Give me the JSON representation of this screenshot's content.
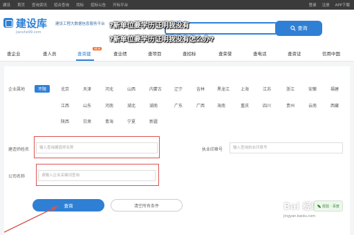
{
  "topbar": {
    "nav": [
      "建设",
      "首页",
      "查询资讯",
      "招合查询",
      "找标",
      "招标公告",
      "开标平台"
    ],
    "right": [
      "登录",
      "注册",
      "APP下载"
    ]
  },
  "header": {
    "logo_text": "建设库",
    "logo_sub": "jianshe99.com",
    "slogan": "建设工程大数据信息服务平台",
    "search_button": "查询"
  },
  "overlay": {
    "line1": "?新单位要学历证明我没有",
    "line2": "?新单位要学历证明我没有怎么办?"
  },
  "subnav": {
    "items": [
      "查企业",
      "查人员",
      "查资建",
      "查业绩",
      "查项目",
      "查招标",
      "查荣誉",
      "查电话",
      "查资证",
      "信用中国"
    ],
    "new_tag": "NEW"
  },
  "filters": {
    "region_label": "企业属地",
    "regions": [
      [
        "不限",
        "北京",
        "天津",
        "河北",
        "山西",
        "内蒙古",
        "辽宁",
        "吉林",
        "黑龙江",
        "上海",
        "江苏",
        "浙江",
        "安徽",
        "福建"
      ],
      [
        "江西",
        "山东",
        "河南",
        "湖北",
        "湖南",
        "广东",
        "广西",
        "海南",
        "重庆",
        "四川",
        "贵州",
        "云南",
        "西藏"
      ],
      [
        "陕西",
        "甘肃",
        "青海",
        "宁夏",
        "新疆"
      ]
    ],
    "name_label": "建造师姓名",
    "name_placeholder": "输入查询建造师名称",
    "cert_label": "执业印章号",
    "cert_placeholder": "输入查询执业印章号",
    "company_label": "公司名称",
    "company_placeholder": "请输入企业关键词查询"
  },
  "actions": {
    "query": "查询",
    "clear": "清空所有条件"
  },
  "watermark": {
    "text": "Bai 经验",
    "url": "jingyan.baidu.com",
    "badge": "经验 · 百度"
  }
}
